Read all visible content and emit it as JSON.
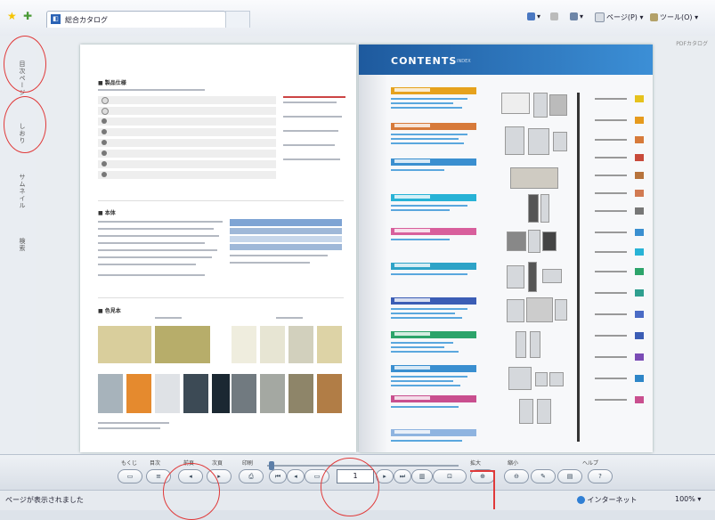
{
  "browser": {
    "tab_title": "総合カタログ",
    "toolbar": {
      "home": "▾",
      "print": "▾",
      "page": "ページ(P) ▾",
      "tools": "ツール(O) ▾",
      "help": "?"
    }
  },
  "viewer": {
    "top_right_label": "PDFカタログ",
    "right_page": {
      "contents_title": "CONTENTS"
    },
    "left_page": {
      "section1_title": "■ 製品仕様",
      "section2_title": "■ 本体",
      "section3_title": "■ 色見本"
    }
  },
  "bottom": {
    "labels": [
      "もくじ",
      "目次",
      "前頁",
      "次頁",
      "印刷",
      "拡大",
      "縮小",
      "ヘルプ"
    ],
    "page_value": "1"
  },
  "status": {
    "left_text": "ページが表示されました",
    "zone": "インターネット",
    "zoom": "100%"
  }
}
